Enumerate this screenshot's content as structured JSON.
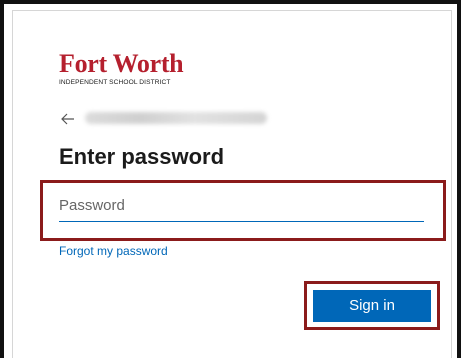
{
  "brand": {
    "name": "Fort Worth",
    "subtitle": "INDEPENDENT SCHOOL DISTRICT",
    "color": "#b5202e"
  },
  "account": {
    "back_icon": "arrow-left-icon",
    "identity": ""
  },
  "page": {
    "title": "Enter password"
  },
  "password_field": {
    "placeholder": "Password",
    "value": ""
  },
  "links": {
    "forgot_password": "Forgot my password"
  },
  "actions": {
    "sign_in_label": "Sign in"
  },
  "colors": {
    "accent": "#0067b8",
    "highlight_border": "#8b1b1b"
  }
}
